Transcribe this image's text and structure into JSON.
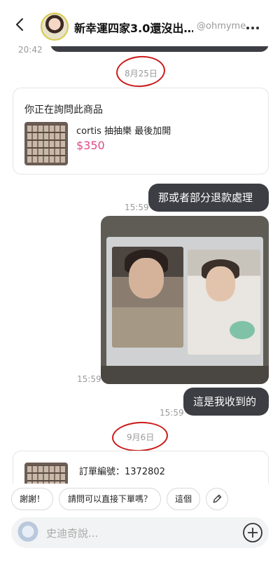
{
  "header": {
    "name": "新幸運四家3.0還沒出…",
    "handle": "@ohmyme"
  },
  "top": {
    "time": "20:42"
  },
  "dates": {
    "first": "8月25日",
    "second": "9月6日"
  },
  "product_card": {
    "title": "你正在詢問此商品",
    "name": "cortis 抽抽樂 最後加開",
    "price": "$350"
  },
  "messages": [
    {
      "text": "那或者部分退款處理",
      "time": "15:59"
    },
    {
      "text": "",
      "time": "15:59"
    },
    {
      "text": "這是我收到的",
      "time": "15:59"
    }
  ],
  "order_card": {
    "text": "訂單編號：1372802"
  },
  "quick_replies": [
    "謝謝！",
    "請問可以直接下單嗎？",
    "這個"
  ],
  "input": {
    "placeholder": "史迪奇說..."
  },
  "colors": {
    "bubble": "#3c3e44",
    "price": "#e04a86",
    "annotation": "#cc1b1b"
  }
}
